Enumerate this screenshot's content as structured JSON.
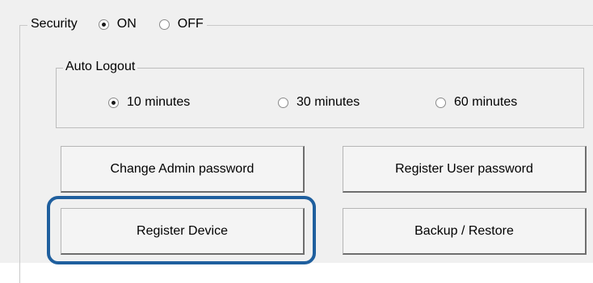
{
  "security": {
    "label": "Security",
    "options": [
      {
        "label": "ON",
        "selected": true
      },
      {
        "label": "OFF",
        "selected": false
      }
    ]
  },
  "auto_logout": {
    "label": "Auto Logout",
    "options": [
      {
        "label": "10 minutes",
        "selected": true
      },
      {
        "label": "30 minutes",
        "selected": false
      },
      {
        "label": "60 minutes",
        "selected": false
      }
    ]
  },
  "buttons": {
    "change_admin_password": "Change Admin password",
    "register_user_password": "Register User password",
    "register_device": "Register Device",
    "backup_restore": "Backup / Restore"
  },
  "colors": {
    "highlight": "#1f5f9e",
    "panel_background": "#f0f0f0"
  }
}
